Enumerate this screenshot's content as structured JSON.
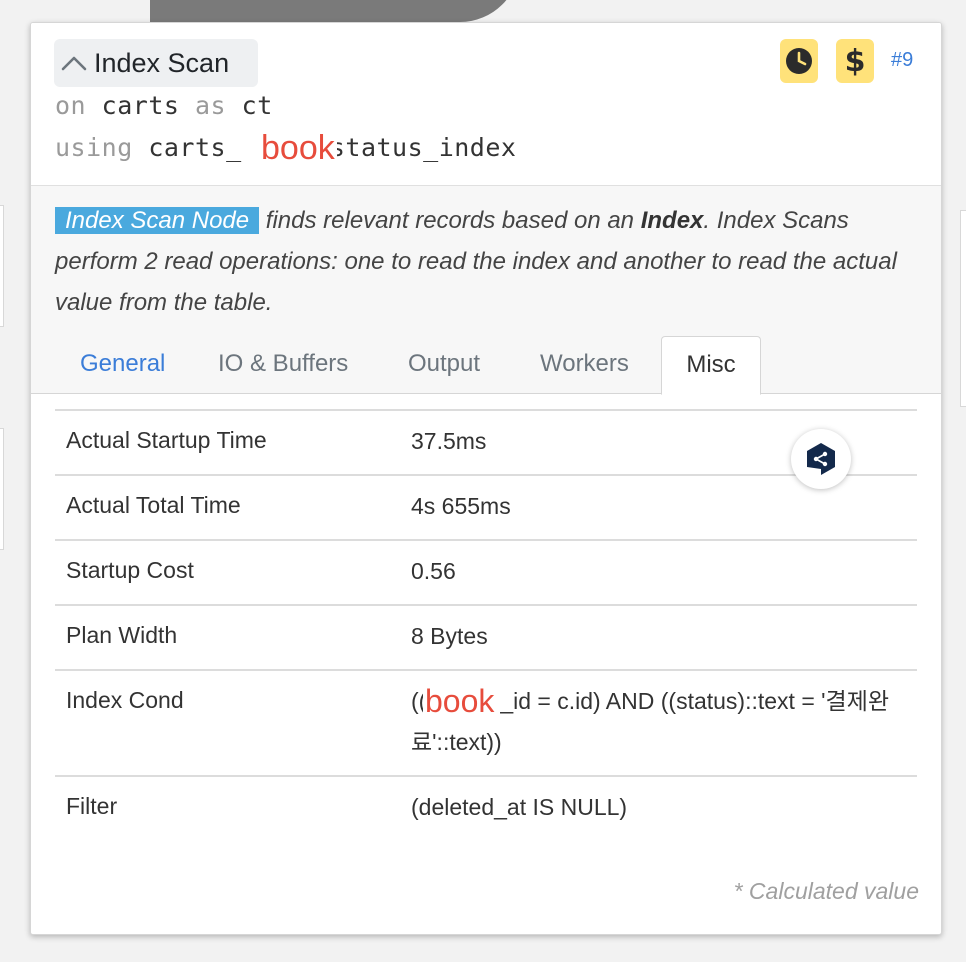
{
  "node": {
    "title": "Index Scan",
    "number": "#9",
    "on_kw": "on",
    "relation": "carts",
    "as_kw": "as",
    "alias": "ct",
    "using_kw": "using",
    "index_prefix": "carts_",
    "index_suffix": "_id_status_index",
    "overlay_text": "book"
  },
  "icons": {
    "collapse": "chevron-up-icon",
    "clock": "clock-icon",
    "cost": "dollar-icon",
    "share": "share-icon"
  },
  "description": {
    "node_tag": "Index Scan Node",
    "part1": "finds relevant records based on an",
    "bold": "Index",
    "part2": ". Index Scans perform 2 read operations: one to read the index and another to read the actual value from the table."
  },
  "tabs": [
    {
      "label": "General"
    },
    {
      "label": "IO & Buffers"
    },
    {
      "label": "Output"
    },
    {
      "label": "Workers"
    },
    {
      "label": "Misc"
    }
  ],
  "active_tab": "Misc",
  "misc": {
    "rows": [
      {
        "label": "Actual Startup Time",
        "value": "37.5ms"
      },
      {
        "label": "Actual Total Time",
        "value": "4s 655ms"
      },
      {
        "label": "Startup Cost",
        "value": "0.56"
      },
      {
        "label": "Plan Width",
        "value": "8 Bytes"
      },
      {
        "label": "Index Cond",
        "value_prefix": "((",
        "value_rest": "_id = c.id) AND ((status)::text = '결제완료'::text))"
      },
      {
        "label": "Filter",
        "value": "(deleted_at IS NULL)"
      }
    ],
    "footnote": "* Calculated value"
  },
  "colors": {
    "accent": "#3b7dd8",
    "badge": "#ffe27a",
    "node_tag": "#4aa9de",
    "annotation": "#e74c3c"
  }
}
